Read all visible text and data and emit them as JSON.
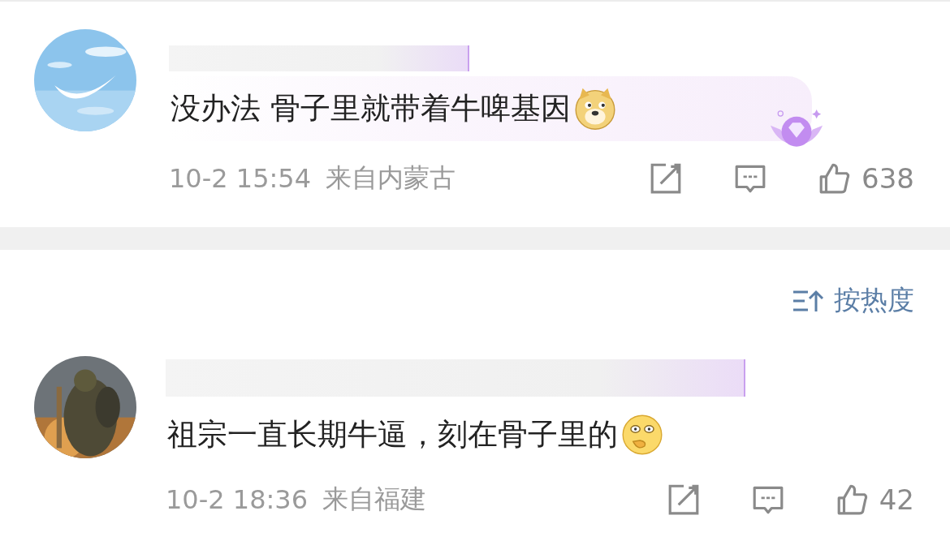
{
  "comments": [
    {
      "avatar": {
        "kind": "sky"
      },
      "text": "没办法 骨子里就带着牛啤基因",
      "emoji": {
        "kind": "dog"
      },
      "bubble": true,
      "badge": true,
      "time": "10-2 15:54",
      "location": "来自内蒙古",
      "likes": "638"
    },
    {
      "avatar": {
        "kind": "figure"
      },
      "text": "祖宗一直长期牛逼，刻在骨子里的",
      "emoji": {
        "kind": "shy"
      },
      "bubble": false,
      "badge": false,
      "time": "10-2 18:36",
      "location": "来自福建",
      "likes": "42"
    }
  ],
  "sort": {
    "label": "按热度"
  }
}
